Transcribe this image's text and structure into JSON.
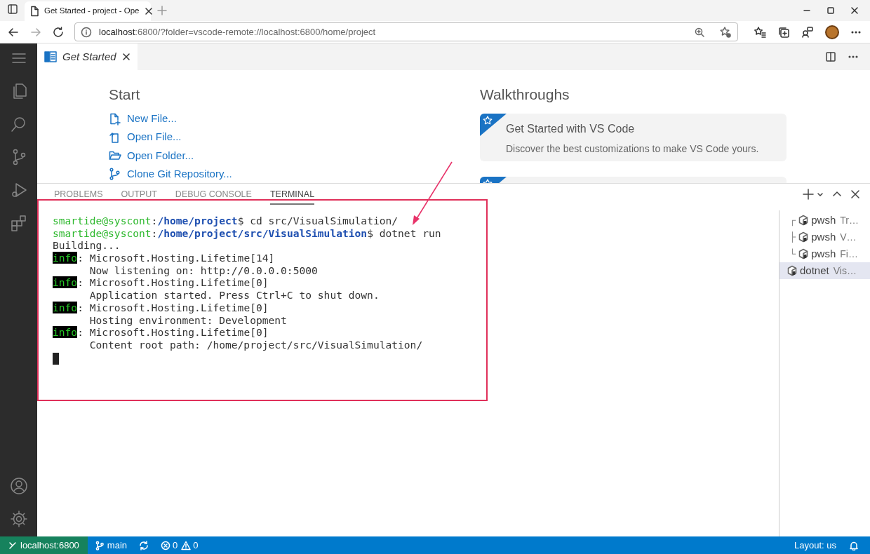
{
  "browser": {
    "tab_title": "Get Started - project - Ope",
    "address": {
      "host": "localhost",
      "rest": ":6800/?folder=vscode-remote://localhost:6800/home/project"
    }
  },
  "editor_tabs": [
    {
      "label": "Get Started",
      "selected": true
    }
  ],
  "start": {
    "title": "Start",
    "items": [
      {
        "kind": "new-file",
        "label": "New File..."
      },
      {
        "kind": "open-file",
        "label": "Open File..."
      },
      {
        "kind": "open-folder",
        "label": "Open Folder..."
      },
      {
        "kind": "clone",
        "label": "Clone Git Repository..."
      }
    ]
  },
  "walkthroughs": {
    "title": "Walkthroughs",
    "cards": [
      {
        "title": "Get Started with VS Code",
        "description": "Discover the best customizations to make VS Code yours."
      }
    ]
  },
  "panel_tabs": [
    {
      "label": "PROBLEMS",
      "selected": false
    },
    {
      "label": "OUTPUT",
      "selected": false
    },
    {
      "label": "DEBUG CONSOLE",
      "selected": false
    },
    {
      "label": "TERMINAL",
      "selected": true
    }
  ],
  "terminal_lines": [
    [
      {
        "kind": "user",
        "text": "smartide@syscont"
      },
      {
        "kind": "plain",
        "text": ":"
      },
      {
        "kind": "path",
        "text": "/home/project"
      },
      {
        "kind": "plain",
        "text": "$ cd src/VisualSimulation/"
      }
    ],
    [
      {
        "kind": "user",
        "text": "smartide@syscont"
      },
      {
        "kind": "plain",
        "text": ":"
      },
      {
        "kind": "path",
        "text": "/home/project/src/VisualSimulation"
      },
      {
        "kind": "plain",
        "text": "$ dotnet run"
      }
    ],
    [
      {
        "kind": "plain",
        "text": "Building..."
      }
    ],
    [
      {
        "kind": "info",
        "text": "info"
      },
      {
        "kind": "plain",
        "text": ": Microsoft.Hosting.Lifetime[14]"
      }
    ],
    [
      {
        "kind": "plain",
        "text": "      Now listening on: http://0.0.0.0:5000"
      }
    ],
    [
      {
        "kind": "info",
        "text": "info"
      },
      {
        "kind": "plain",
        "text": ": Microsoft.Hosting.Lifetime[0]"
      }
    ],
    [
      {
        "kind": "plain",
        "text": "      Application started. Press Ctrl+C to shut down."
      }
    ],
    [
      {
        "kind": "info",
        "text": "info"
      },
      {
        "kind": "plain",
        "text": ": Microsoft.Hosting.Lifetime[0]"
      }
    ],
    [
      {
        "kind": "plain",
        "text": "      Hosting environment: Development"
      }
    ],
    [
      {
        "kind": "info",
        "text": "info"
      },
      {
        "kind": "plain",
        "text": ": Microsoft.Hosting.Lifetime[0]"
      }
    ],
    [
      {
        "kind": "plain",
        "text": "      Content root path: /home/project/src/VisualSimulation/"
      }
    ]
  ],
  "terminals": [
    {
      "tree": "┌",
      "name": "pwsh",
      "title": "Tr…",
      "selected": false
    },
    {
      "tree": "├",
      "name": "pwsh",
      "title": "V…",
      "selected": false
    },
    {
      "tree": "└",
      "name": "pwsh",
      "title": "Fi…",
      "selected": false
    },
    {
      "name": "dotnet",
      "title": "Vis…",
      "selected": true
    }
  ],
  "status_bar": {
    "remote": "localhost:6800",
    "branch": "main",
    "errors": "0",
    "warnings": "0",
    "layout": "Layout: us"
  }
}
